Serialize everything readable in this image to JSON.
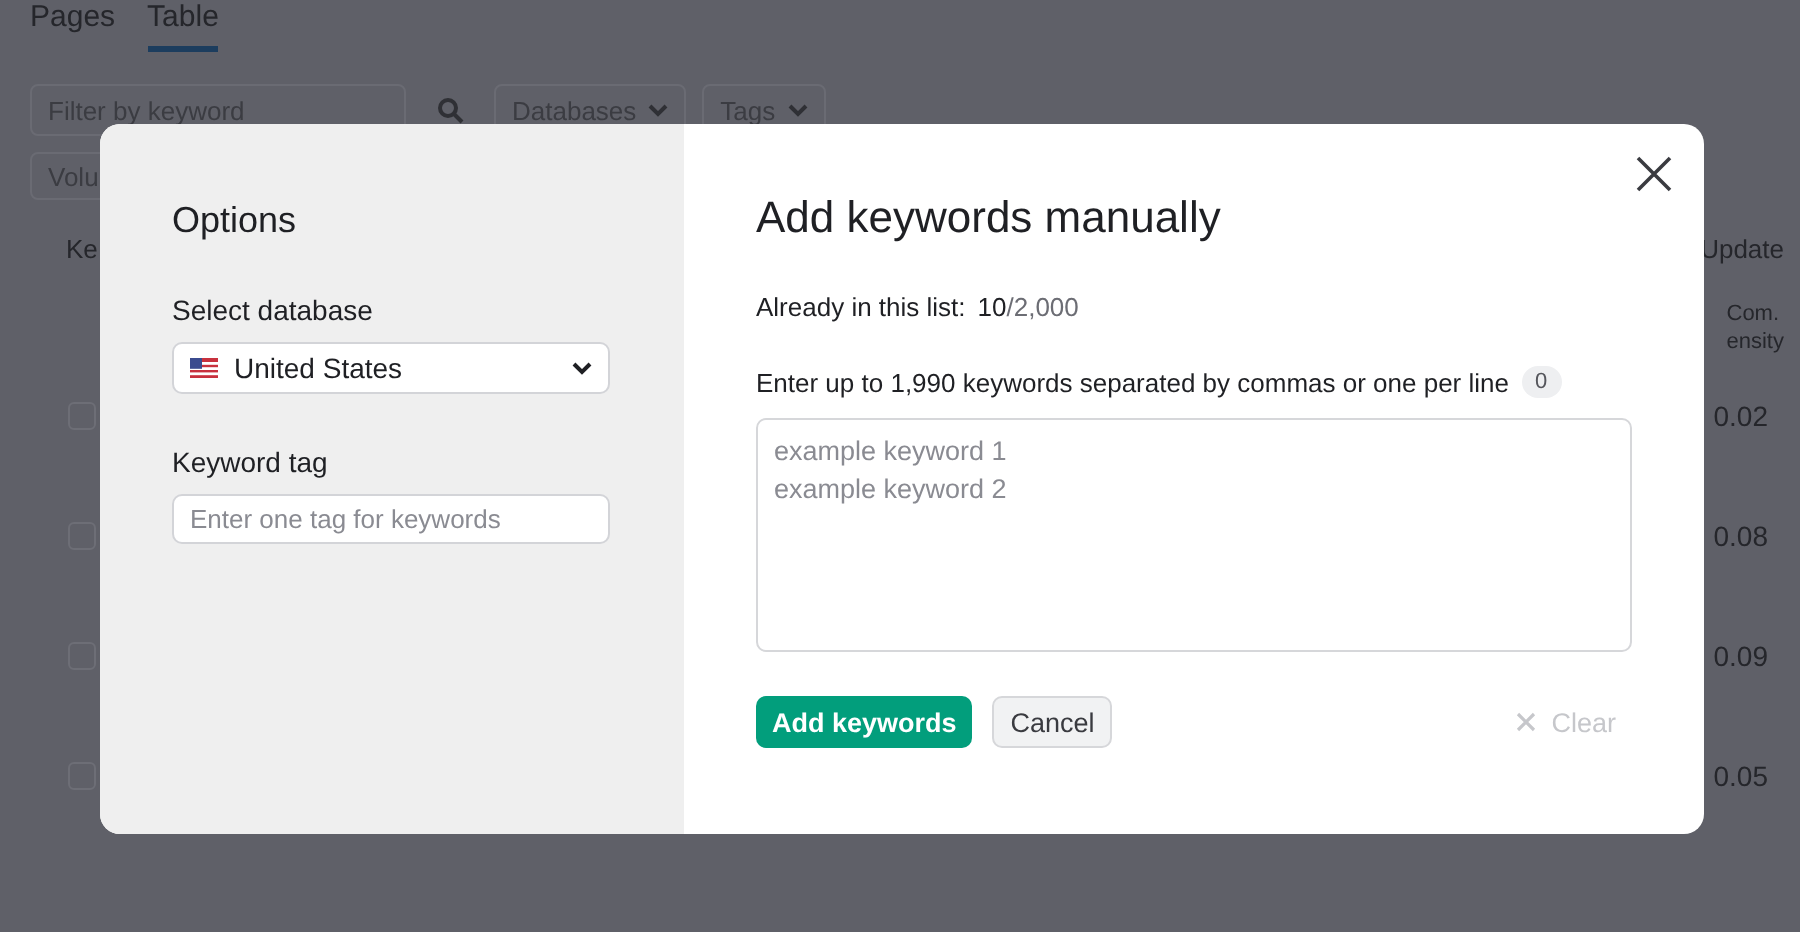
{
  "background": {
    "tabs": [
      {
        "label": "Pages",
        "selected": false
      },
      {
        "label": "Table",
        "selected": true
      }
    ],
    "filter": {
      "placeholder": "Filter by keyword"
    },
    "dropdowns": [
      "Databases",
      "Tags"
    ],
    "volume_filter": "Volu",
    "table": {
      "first_column": "Ke",
      "last_column": "Update",
      "subheader_lines": [
        "Com.",
        "ensity"
      ],
      "rows": [
        {
          "checked": false,
          "value": "0.02"
        },
        {
          "checked": false,
          "value": "0.08"
        },
        {
          "checked": false,
          "value": "0.09"
        },
        {
          "checked": false,
          "value": "0.05"
        }
      ]
    }
  },
  "dialog": {
    "options_title": "Options",
    "database_label": "Select database",
    "database": "United States",
    "tag_label": "Keyword tag",
    "tag_placeholder": "Enter one tag for keywords",
    "title": "Add keywords manually",
    "already_label": "Already in this list:",
    "count": "10",
    "limit": "/2,000",
    "instructions": "Enter up to 1,990 keywords separated by commas or one per line",
    "entered_count": "0",
    "textarea_placeholder": "example keyword 1\nexample keyword 2",
    "add_button": "Add keywords",
    "cancel_button": "Cancel",
    "clear_button": "Clear"
  }
}
